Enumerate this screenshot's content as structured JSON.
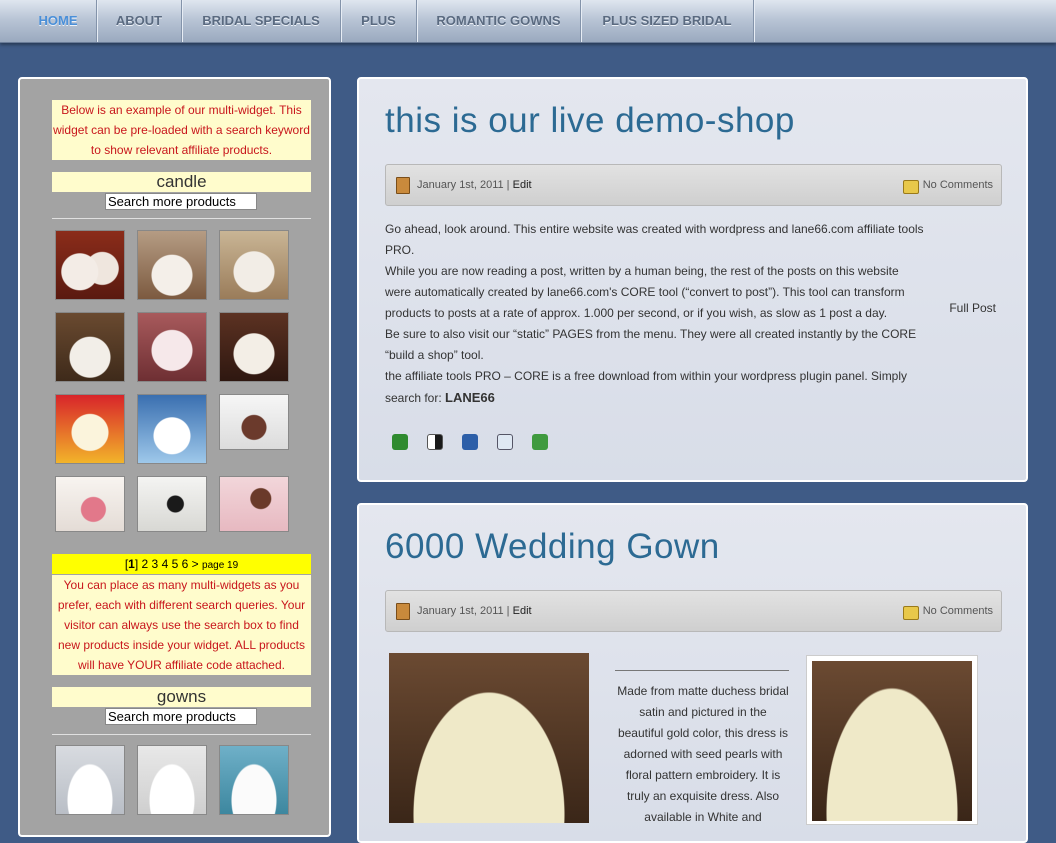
{
  "nav": {
    "items": [
      "HOME",
      "ABOUT",
      "BRIDAL SPECIALS",
      "PLUS",
      "ROMANTIC GOWNS",
      "PLUS SIZED BRIDAL"
    ]
  },
  "sidebar": {
    "intro": "Below is an example of our multi-widget. This widget can be pre-loaded with a search keyword to show relevant affiliate products.",
    "widgets": [
      {
        "keyword": "candle",
        "search_placeholder": "Search more products"
      },
      {
        "keyword": "gowns",
        "search_placeholder": "Search more products"
      }
    ],
    "pager": {
      "current": "1",
      "pages": [
        "2",
        "3",
        "4",
        "5",
        "6"
      ],
      "next": ">",
      "page_label": "page 19"
    },
    "note": "You can place as many multi-widgets as you prefer, each with different search queries. Your visitor can always use the search box to find new products inside your widget. ALL products will have YOUR affiliate code attached."
  },
  "posts": [
    {
      "title": "this is our live demo-shop",
      "date": "January 1st, 2011 |",
      "edit": "Edit",
      "comments": "No Comments",
      "paragraphs": [
        "Go ahead, look around. This entire website was created with wordpress and lane66.com affiliate tools PRO.",
        "While you are now reading a post, written by a human being, the rest of the posts on this website were automatically created by lane66.com's CORE tool (“convert to post”). This tool can transform products to posts at a rate of approx. 1.000 per second, or if you wish, as slow as 1 post a day.",
        "Be sure to also visit our “static” PAGES from the menu. They were all created instantly by the CORE “build a shop” tool.",
        "the affiliate tools PRO – CORE is a free download from within your wordpress plugin panel. Simply search for:"
      ],
      "search_keyword": "LANE66",
      "full_post": "Full Post",
      "share_icons": [
        "technorati-icon",
        "delicious-icon",
        "digg-icon",
        "reddit-icon",
        "stumbleupon-icon"
      ]
    },
    {
      "title": "6000 Wedding Gown",
      "date": "January 1st, 2011 |",
      "edit": "Edit",
      "comments": "No Comments",
      "description": "Made from matte duchess bridal satin and pictured in the beautiful gold color, this dress is adorned with seed pearls with floral pattern embroidery. It is truly an exquisite dress. Also available in White and"
    }
  ],
  "colors": {
    "background": "#3f5b86",
    "title": "#2c6a93",
    "note_bg": "#fffccc",
    "note_text": "#c8161c",
    "pager_bg": "#ffff00",
    "nav_active": "#4a8fd8"
  }
}
